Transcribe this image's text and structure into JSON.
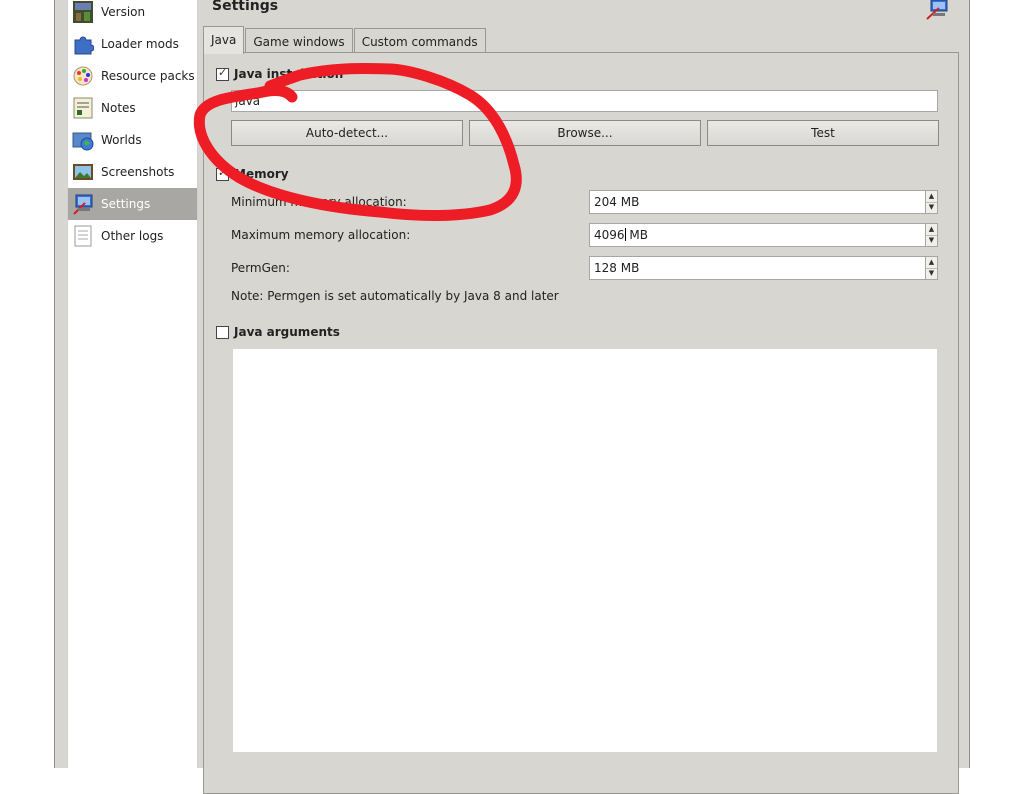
{
  "sidebar": {
    "items": [
      {
        "label": "Version",
        "icon": "version-icon"
      },
      {
        "label": "Loader mods",
        "icon": "puzzle-icon"
      },
      {
        "label": "Resource packs",
        "icon": "palette-icon"
      },
      {
        "label": "Notes",
        "icon": "notes-icon"
      },
      {
        "label": "Worlds",
        "icon": "worlds-icon"
      },
      {
        "label": "Screenshots",
        "icon": "screenshot-icon"
      },
      {
        "label": "Settings",
        "icon": "settings-icon",
        "selected": true
      },
      {
        "label": "Other logs",
        "icon": "log-icon"
      }
    ]
  },
  "header": {
    "title": "Settings",
    "icon": "settings-icon"
  },
  "tabs": [
    {
      "label": "Java",
      "active": true
    },
    {
      "label": "Game windows"
    },
    {
      "label": "Custom commands"
    }
  ],
  "java_installation": {
    "label": "Java installation",
    "checked": true,
    "path_value": "java",
    "auto_detect_label": "Auto-detect...",
    "browse_label": "Browse...",
    "test_label": "Test"
  },
  "memory": {
    "label": "Memory",
    "checked": true,
    "min_label": "Minimum memory allocation:",
    "min_value": "204 MB",
    "max_label": "Maximum memory allocation:",
    "max_value_num": "4096",
    "max_value_unit": " MB",
    "permgen_label": "PermGen:",
    "permgen_value": "128 MB",
    "note": "Note: Permgen is set automatically by Java 8 and later"
  },
  "java_arguments": {
    "label": "Java arguments",
    "checked": false,
    "value": ""
  },
  "colors": {
    "window_bg": "#d8d6d1",
    "sidebar_selected": "#a9a7a3",
    "annotation_red": "#ee1c24"
  }
}
